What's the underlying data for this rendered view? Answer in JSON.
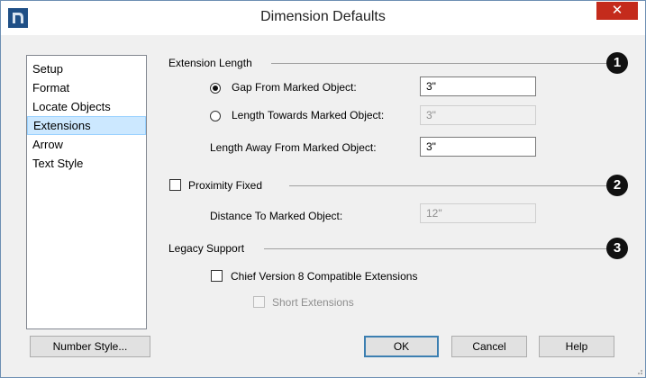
{
  "window": {
    "title": "Dimension Defaults",
    "close_glyph": "✕"
  },
  "nav": {
    "items": [
      {
        "label": "Setup"
      },
      {
        "label": "Format"
      },
      {
        "label": "Locate Objects"
      },
      {
        "label": "Extensions",
        "selected": true
      },
      {
        "label": "Arrow"
      },
      {
        "label": "Text Style"
      }
    ]
  },
  "extension_length": {
    "heading": "Extension Length",
    "callout": "1",
    "gap_option": {
      "label": "Gap From Marked Object:",
      "value": "3\"",
      "checked": true
    },
    "length_towards_option": {
      "label": "Length Towards Marked Object:",
      "value": "3\"",
      "checked": false
    },
    "length_away": {
      "label": "Length Away From Marked Object:",
      "value": "3\""
    }
  },
  "proximity": {
    "label": "Proximity Fixed",
    "checked": false,
    "callout": "2",
    "distance": {
      "label": "Distance To Marked Object:",
      "value": "12\""
    }
  },
  "legacy": {
    "heading": "Legacy Support",
    "callout": "3",
    "chief_v8": {
      "label": "Chief Version 8 Compatible Extensions",
      "checked": false
    },
    "short_extensions": {
      "label": "Short Extensions",
      "checked": false
    }
  },
  "buttons": {
    "number_style": "Number Style...",
    "ok": "OK",
    "cancel": "Cancel",
    "help": "Help"
  },
  "colors": {
    "accent": "#3c7fb1",
    "close": "#c42b1c",
    "selection": "#cce8ff"
  }
}
